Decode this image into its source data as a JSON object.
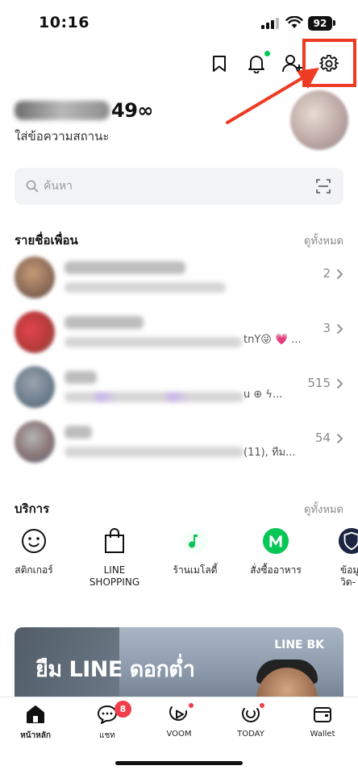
{
  "status_bar": {
    "time": "10:16",
    "battery": "92"
  },
  "header": {
    "icons": [
      "bookmark-icon",
      "bell-icon",
      "add-friend-icon",
      "gear-icon"
    ],
    "highlight_color": "#ee3b23",
    "notification_dot_color": "#06c755"
  },
  "profile": {
    "name_visible_suffix": "49∞",
    "status_message": "ใส่ข้อความสถานะ"
  },
  "search": {
    "placeholder": "ค้นหา"
  },
  "friends": {
    "title": "รายชื่อเพื่อน",
    "see_all": "ดูทั้งหมด",
    "rows": [
      {
        "count": "2",
        "message_tail": ""
      },
      {
        "count": "3",
        "message_tail": "tnY😜 💗 ..."
      },
      {
        "count": "515",
        "message_tail": "u ⊕ ϟ..."
      },
      {
        "count": "54",
        "message_tail": "(11), ทีม..."
      }
    ]
  },
  "services": {
    "title": "บริการ",
    "see_all": "ดูทั้งหมด",
    "items": [
      {
        "label": "สติกเกอร์",
        "icon": "smiley-icon"
      },
      {
        "label": "LINE\nSHOPPING",
        "icon": "shopping-bag-icon"
      },
      {
        "label": "ร้านเมโลดี้",
        "icon": "melody-icon"
      },
      {
        "label": "สั่งซื้ออาหาร",
        "icon": "line-man-icon"
      },
      {
        "label": "ข้อมู\nวิด-",
        "icon": "shield-icon"
      }
    ]
  },
  "banner": {
    "headline": "ยืม LINE ดอกต่ำ",
    "brand": "LINE BK"
  },
  "bottom_nav": {
    "items": [
      {
        "label": "หน้าหลัก",
        "icon": "home-icon",
        "active": true
      },
      {
        "label": "แชท",
        "icon": "chat-icon",
        "badge": "8"
      },
      {
        "label": "VOOM",
        "icon": "voom-icon"
      },
      {
        "label": "TODAY",
        "icon": "today-icon"
      },
      {
        "label": "Wallet",
        "icon": "wallet-icon"
      }
    ],
    "badge_color": "#ef3e4a"
  },
  "colors": {
    "line_green": "#06c755",
    "annotation_red": "#ee3b23"
  }
}
